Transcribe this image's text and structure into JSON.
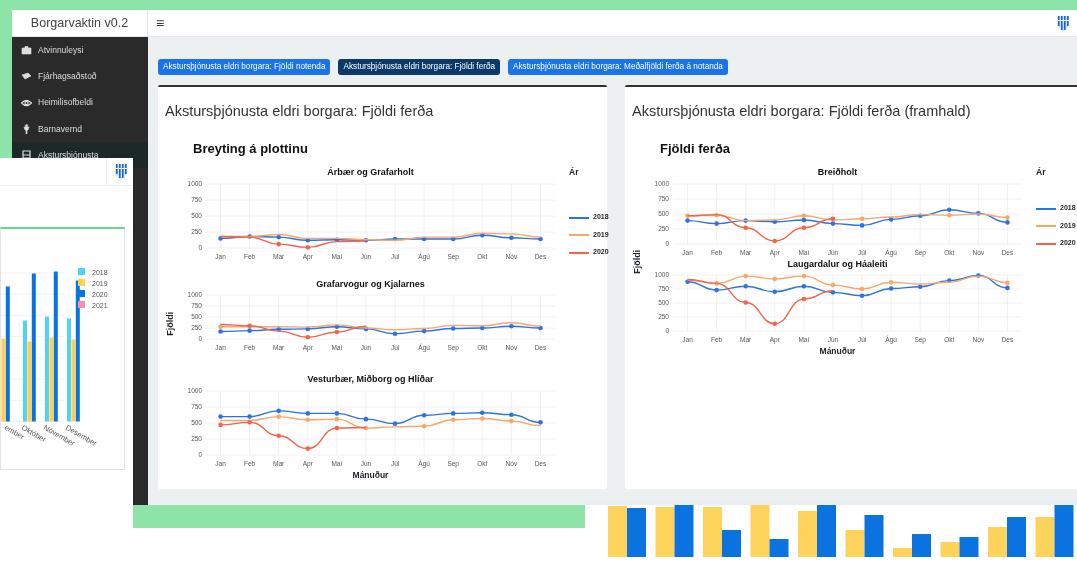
{
  "navbar": {
    "brand": "Borgarvaktin v0.2",
    "menu_glyph": "≡"
  },
  "sidebar": {
    "items": [
      {
        "label": "Atvinnuleysi",
        "selected": false
      },
      {
        "label": "Fjárhagsaðstoð",
        "selected": false
      },
      {
        "label": "Heimilisofbeldi",
        "selected": false
      },
      {
        "label": "Barnavernd",
        "selected": false
      },
      {
        "label": "Akstursþjónusta",
        "selected": true
      }
    ]
  },
  "tabs": [
    {
      "label": "Akstursþjónusta eldri borgara: Fjöldi notenda",
      "selected": false
    },
    {
      "label": "Akstursþjónusta eldri borgara: Fjöldi ferða",
      "selected": true
    },
    {
      "label": "Akstursþjónusta eldri borgara: Meðalfjöldi ferða á notanda",
      "selected": false
    }
  ],
  "panels": [
    {
      "title": "Akstursþjónusta eldri borgara: Fjöldi ferða",
      "figure": {
        "title": "Breyting á plottinu",
        "ylabel": "Fjöldi",
        "xlabel": "Mánuður",
        "legend": {
          "title": "Ár"
        },
        "charts": [
          {
            "chart_data": {
              "type": "line",
              "grid": true,
              "title": "Árbær og Grafarholt",
              "categories": [
                "Jan",
                "Feb",
                "Mar",
                "Apr",
                "Maí",
                "Jún",
                "Júl",
                "Ágú",
                "Sep",
                "Okt",
                "Nóv",
                "Des"
              ],
              "ylim": [
                0,
                1000
              ],
              "yticks": [
                0,
                250,
                500,
                750,
                1000
              ],
              "series": [
                {
                  "name": "2018",
                  "color": "#2c72e6",
                  "values": [
                    150,
                    180,
                    170,
                    120,
                    130,
                    120,
                    140,
                    140,
                    140,
                    200,
                    160,
                    140
                  ]
                },
                {
                  "name": "2019",
                  "color": "#f7a76a",
                  "values": [
                    180,
                    180,
                    210,
                    150,
                    150,
                    130,
                    120,
                    170,
                    170,
                    230,
                    220,
                    170
                  ]
                },
                {
                  "name": "2020",
                  "color": "#f2654a",
                  "values": [
                    180,
                    170,
                    60,
                    10,
                    100,
                    110,
                    null,
                    null,
                    null,
                    null,
                    null,
                    null
                  ]
                }
              ]
            }
          },
          {
            "chart_data": {
              "type": "line",
              "grid": true,
              "title": "Grafarvogur og Kjalarnes",
              "categories": [
                "Jan",
                "Feb",
                "Mar",
                "Apr",
                "Maí",
                "Jún",
                "Júl",
                "Ágú",
                "Sep",
                "Okt",
                "Nóv",
                "Des"
              ],
              "ylim": [
                0,
                1000
              ],
              "yticks": [
                0,
                250,
                500,
                750,
                1000
              ],
              "series": [
                {
                  "color": "#2c72e6",
                  "values": [
                    170,
                    190,
                    220,
                    230,
                    280,
                    230,
                    120,
                    180,
                    240,
                    250,
                    290,
                    250
                  ]
                },
                {
                  "color": "#f7a76a",
                  "values": [
                    280,
                    280,
                    280,
                    270,
                    320,
                    250,
                    210,
                    240,
                    310,
                    300,
                    370,
                    290
                  ]
                },
                {
                  "color": "#f2654a",
                  "values": [
                    330,
                    300,
                    180,
                    40,
                    160,
                    290,
                    null,
                    null,
                    null,
                    null,
                    null,
                    null
                  ]
                }
              ]
            }
          },
          {
            "chart_data": {
              "type": "line",
              "grid": true,
              "title": "Vesturbær, Miðborg og Hlíðar",
              "categories": [
                "Jan",
                "Feb",
                "Mar",
                "Apr",
                "Maí",
                "Jún",
                "Júl",
                "Ágú",
                "Sep",
                "Okt",
                "Nóv",
                "Des"
              ],
              "ylim": [
                0,
                1000
              ],
              "yticks": [
                0,
                250,
                500,
                750,
                1000
              ],
              "series": [
                {
                  "color": "#2c72e6",
                  "values": [
                    600,
                    600,
                    690,
                    650,
                    650,
                    560,
                    490,
                    620,
                    650,
                    660,
                    630,
                    510
                  ]
                },
                {
                  "color": "#f7a76a",
                  "values": [
                    540,
                    540,
                    600,
                    550,
                    560,
                    420,
                    440,
                    450,
                    550,
                    570,
                    530,
                    460
                  ]
                },
                {
                  "color": "#f2654a",
                  "values": [
                    470,
                    510,
                    300,
                    100,
                    420,
                    430,
                    null,
                    null,
                    null,
                    null,
                    null,
                    null
                  ]
                }
              ]
            }
          }
        ]
      }
    },
    {
      "title": "Akstursþjónusta eldri borgara: Fjöldi ferða (framhald)",
      "figure": {
        "title": "Fjöldi ferða",
        "ylabel": "Fjöldi",
        "xlabel": "Mánuður",
        "legend": {
          "title": "Ár"
        },
        "charts": [
          {
            "chart_data": {
              "type": "line",
              "grid": true,
              "title": "Breiðholt",
              "categories": [
                "Jan",
                "Feb",
                "Mar",
                "Apr",
                "Maí",
                "Jún",
                "Júl",
                "Ágú",
                "Sep",
                "Okt",
                "Nóv",
                "Des"
              ],
              "ylim": [
                0,
                1000
              ],
              "yticks": [
                0,
                250,
                500,
                750,
                1000
              ],
              "series": [
                {
                  "name": "2018",
                  "color": "#2c72e6",
                  "values": [
                    390,
                    340,
                    390,
                    370,
                    400,
                    340,
                    310,
                    410,
                    470,
                    570,
                    510,
                    360
                  ]
                },
                {
                  "name": "2019",
                  "color": "#f7a76a",
                  "values": [
                    470,
                    480,
                    390,
                    400,
                    470,
                    400,
                    420,
                    450,
                    490,
                    480,
                    500,
                    440
                  ]
                },
                {
                  "name": "2020",
                  "color": "#f2654a",
                  "values": [
                    470,
                    490,
                    270,
                    50,
                    270,
                    420,
                    null,
                    null,
                    null,
                    null,
                    null,
                    null
                  ]
                }
              ]
            }
          },
          {
            "chart_data": {
              "type": "line",
              "grid": true,
              "title": "Laugardalur og Háaleiti",
              "categories": [
                "Jan",
                "Feb",
                "Mar",
                "Apr",
                "Maí",
                "Jún",
                "Júl",
                "Ágú",
                "Sep",
                "Okt",
                "Nóv",
                "Des"
              ],
              "ylim": [
                0,
                1000
              ],
              "yticks": [
                0,
                250,
                500,
                750,
                1000
              ],
              "series": [
                {
                  "color": "#2c72e6",
                  "values": [
                    880,
                    730,
                    800,
                    700,
                    800,
                    690,
                    630,
                    760,
                    790,
                    900,
                    990,
                    770
                  ]
                },
                {
                  "color": "#f7a76a",
                  "values": [
                    910,
                    850,
                    980,
                    930,
                    980,
                    820,
                    750,
                    870,
                    840,
                    870,
                    980,
                    860
                  ]
                },
                {
                  "color": "#f2654a",
                  "values": [
                    920,
                    850,
                    510,
                    130,
                    570,
                    720,
                    null,
                    null,
                    null,
                    null,
                    null,
                    null
                  ]
                }
              ]
            }
          }
        ]
      }
    }
  ],
  "overlay_window": {
    "legend": [
      {
        "label": "2018",
        "color": "#4fd3f7"
      },
      {
        "label": "2019",
        "color": "#ffd04d"
      },
      {
        "label": "2020",
        "color": "#0a73e0"
      },
      {
        "label": "2021",
        "color": "#f590b4"
      }
    ],
    "month_labels": [
      "ember",
      "Október",
      "Nóvember",
      "Desember"
    ]
  }
}
